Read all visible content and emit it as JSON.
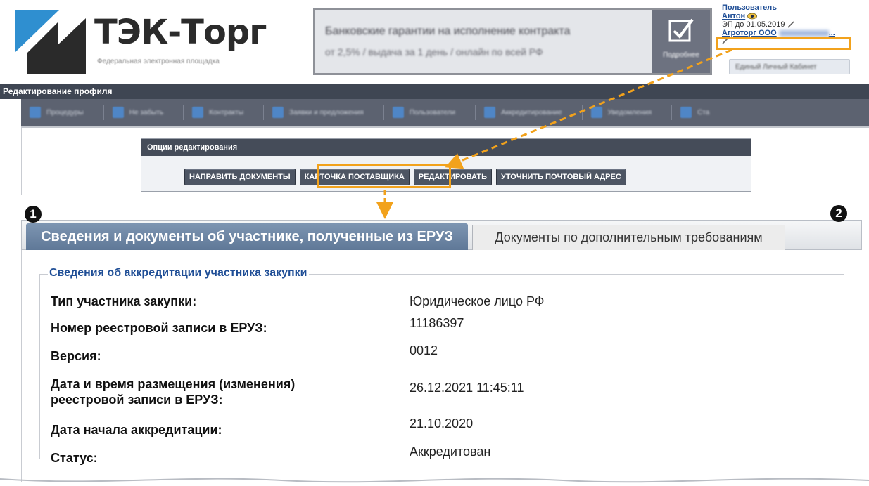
{
  "header": {
    "logo_title": "ТЭК-Торг",
    "logo_subtitle": "Федеральная электронная площадка",
    "banner": {
      "line1": "Банковские гарантии на исполнение контракта",
      "line2": "от 2,5% / выдача за 1 день / онлайн по всей РФ",
      "side_label": "Подробнее"
    },
    "user": {
      "heading": "Пользователь",
      "name": "Антон",
      "ep": "ЭП до 01.05.2019",
      "org": "Агроторг ООО",
      "org_suffix": "..."
    },
    "lk_button": "Единый Личный Кабинет"
  },
  "title_bar": "Редактирование профиля",
  "nav": {
    "items": [
      {
        "label": "Процедуры"
      },
      {
        "label": "Не забыть"
      },
      {
        "label": "Контракты"
      },
      {
        "label": "Заявки и предложения"
      },
      {
        "label": "Пользователи"
      },
      {
        "label": "Аккредитирование"
      },
      {
        "label": "Уведомления"
      },
      {
        "label": "Ста"
      }
    ]
  },
  "options": {
    "heading": "Опции редактирования",
    "buttons": [
      "НАПРАВИТЬ ДОКУМЕНТЫ",
      "КАРТОЧКА ПОСТАВЩИКА",
      "РЕДАКТИРОВАТЬ",
      "УТОЧНИТЬ ПОЧТОВЫЙ АДРЕС"
    ]
  },
  "tabs": {
    "active": "Сведения и документы об участнике, полученные из ЕРУЗ",
    "inactive": "Документы по дополнительным требованиям",
    "badge1": "1",
    "badge2": "2"
  },
  "section": {
    "legend": "Сведения об аккредитации участника закупки",
    "rows": [
      {
        "label": "Тип участника закупки:",
        "value": "Юридическое лицо РФ"
      },
      {
        "label": "Номер реестровой записи в ЕРУЗ:",
        "value": "11186397"
      },
      {
        "label": "Версия:",
        "value": "0012"
      },
      {
        "label": "Дата и время размещения (изменения)",
        "label2": "реестровой записи в ЕРУЗ:",
        "value": "26.12.2021 11:45:11"
      },
      {
        "label": "Дата начала аккредитации:",
        "value": "21.10.2020"
      },
      {
        "label": "Статус:",
        "value": "Аккредитован"
      }
    ]
  },
  "colors": {
    "highlight": "#f2a21c",
    "nav_dark": "#3f4653",
    "tab_active": "#6b84a3",
    "link_blue": "#1f4e96"
  }
}
